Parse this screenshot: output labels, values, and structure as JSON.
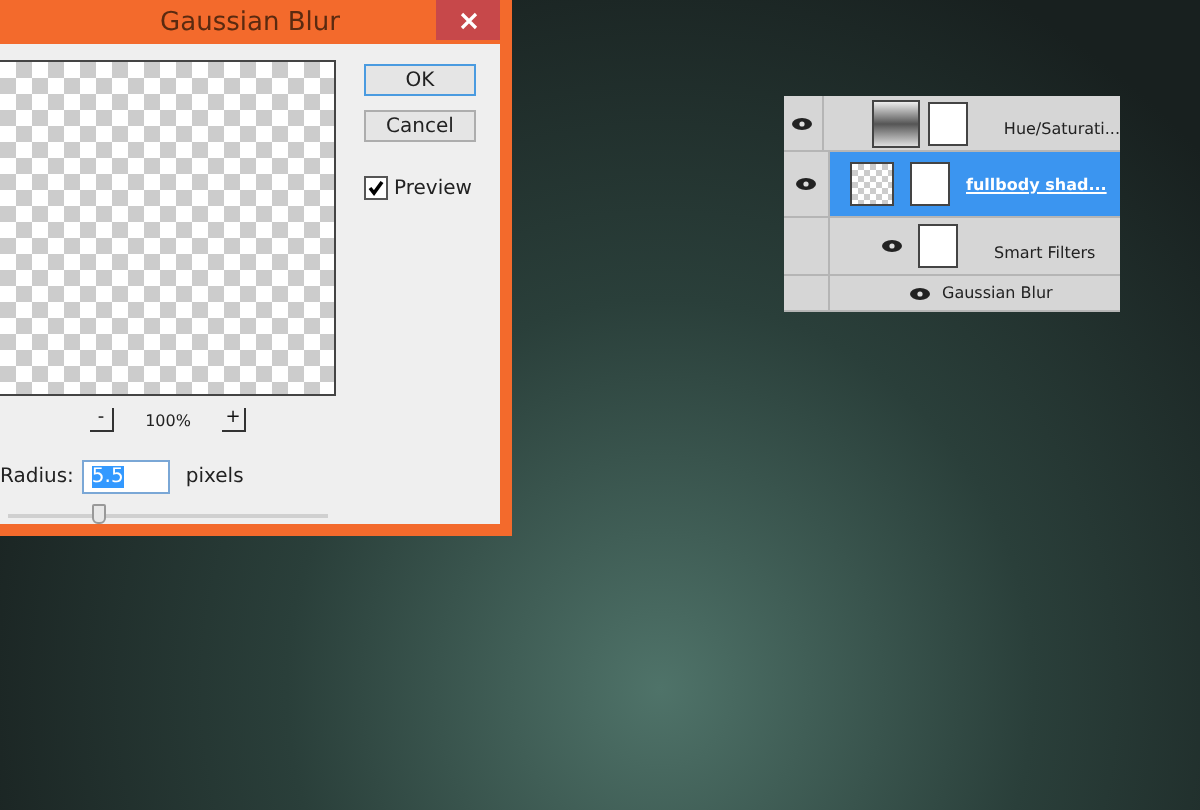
{
  "dialog": {
    "title": "Gaussian Blur",
    "buttons": [
      "OK",
      "Cancel"
    ],
    "preview": {
      "label": "Preview",
      "checked": true
    },
    "zoom": {
      "minus": "-",
      "value": "100%",
      "plus": "+"
    },
    "radius": {
      "label": "Radius:",
      "value": "5.5",
      "unit": "pixels"
    },
    "slider": {
      "level": 0.28
    }
  },
  "layers": [
    {
      "kind": "adjustment",
      "name": "Hue/Saturati...",
      "visible": true,
      "selected": false
    },
    {
      "kind": "smart",
      "name": "fullbody shad...",
      "visible": true,
      "selected": true
    },
    {
      "kind": "filters",
      "name": "Smart Filters",
      "visible": true,
      "selected": false
    },
    {
      "kind": "filter",
      "name": "Gaussian Blur",
      "visible": true,
      "selected": false
    }
  ]
}
